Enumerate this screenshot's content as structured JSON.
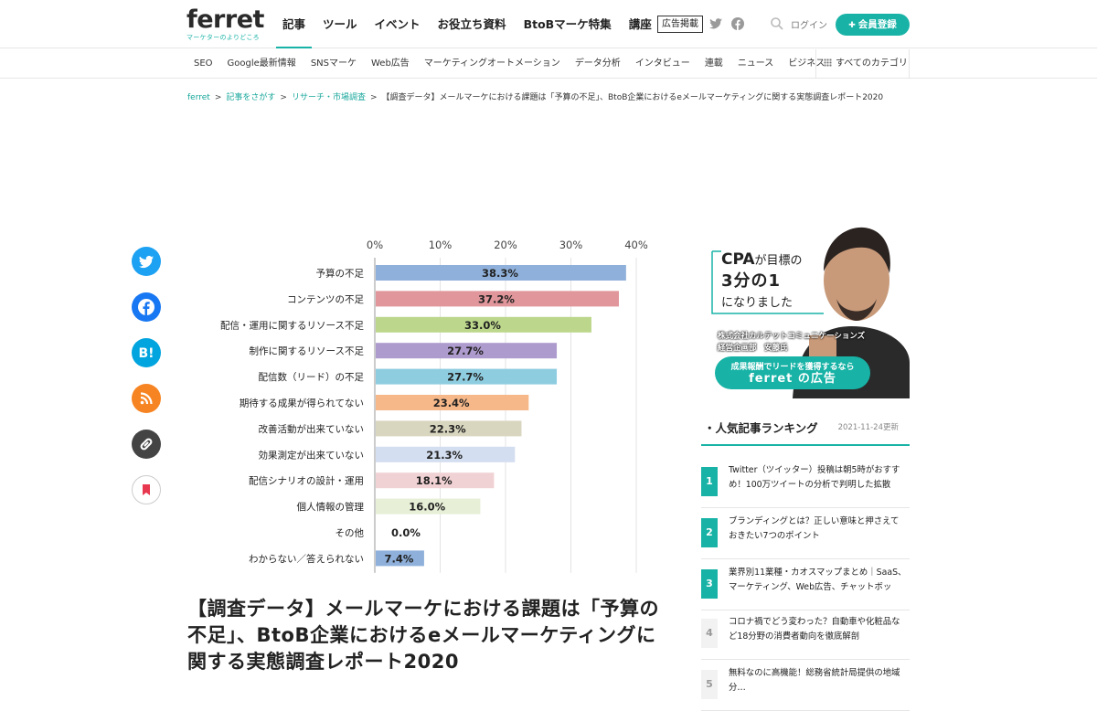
{
  "header": {
    "logo": "ferret",
    "logo_tagline": "マーケターのよりどころ",
    "nav": [
      "記事",
      "ツール",
      "イベント",
      "お役立ち資料",
      "BtoBマーケ特集",
      "講座"
    ],
    "ad_label": "広告掲載",
    "login": "ログイン",
    "signup": "会員登録"
  },
  "subnav": {
    "items": [
      "SEO",
      "Google最新情報",
      "SNSマーケ",
      "Web広告",
      "マーケティングオートメーション",
      "データ分析",
      "インタビュー",
      "連載",
      "ニュース",
      "ビジネス"
    ],
    "all_categories": "すべてのカテゴリ"
  },
  "breadcrumb": {
    "items": [
      "ferret",
      "記事をさがす",
      "リサーチ・市場調査"
    ],
    "current": "【調査データ】メールマーケにおける課題は「予算の不足」、BtoB企業におけるeメールマーケティングに関する実態調査レポート2020"
  },
  "share": [
    "twitter-icon",
    "facebook-icon",
    "hatena-bookmark-icon",
    "rss-icon",
    "link-icon",
    "bookmark-icon"
  ],
  "chart_data": {
    "type": "bar",
    "orientation": "horizontal",
    "xlim": [
      0,
      40
    ],
    "x_ticks": [
      "0%",
      "10%",
      "20%",
      "30%",
      "40%"
    ],
    "categories": [
      "予算の不足",
      "コンテンツの不足",
      "配信・運用に関するリソース不足",
      "制作に関するリソース不足",
      "配信数（リード）の不足",
      "期待する成果が得られてない",
      "改善活動が出来ていない",
      "効果測定が出来ていない",
      "配信シナリオの設計・運用",
      "個人情報の管理",
      "その他",
      "わからない／答えられない"
    ],
    "values": [
      38.3,
      37.2,
      33.0,
      27.7,
      27.7,
      23.4,
      22.3,
      21.3,
      18.1,
      16.0,
      0.0,
      7.4
    ],
    "value_labels": [
      "38.3%",
      "37.2%",
      "33.0%",
      "27.7%",
      "27.7%",
      "23.4%",
      "22.3%",
      "21.3%",
      "18.1%",
      "16.0%",
      "0.0%",
      "7.4%"
    ],
    "colors": [
      "#8fb0da",
      "#e0969a",
      "#bcd78b",
      "#ae9bcd",
      "#8ecde0",
      "#f6b889",
      "#d9d6bf",
      "#d3def0",
      "#f1d2d4",
      "#e7efd6",
      "#cccccc",
      "#8fb0da"
    ]
  },
  "article": {
    "title": "【調査データ】メールマーケにおける課題は「予算の不足」、BtoB企業におけるeメールマーケティングに関する実態調査レポート2020"
  },
  "ad": {
    "headline_1": "CPA",
    "headline_2": "が目標の",
    "headline_3": "3分の1",
    "headline_4": "になりました",
    "company": "株式会社カルテットコミュニケーションズ",
    "person": "経営企画部　安藤氏",
    "cta_1": "成果報酬でリードを獲得するなら",
    "cta_2": "ferret の広告"
  },
  "ranking": {
    "title": "・人気記事ランキング",
    "updated": "2021-11-24更新",
    "items": [
      {
        "rank": "1",
        "text": "Twitter（ツイッター）投稿は朝5時がおすすめ！100万ツイートの分析で判明した拡散（…"
      },
      {
        "rank": "2",
        "text": "ブランディングとは？正しい意味と押さえておきたい7つのポイント"
      },
      {
        "rank": "3",
        "text": "業界別11業種・カオスマップまとめ｜SaaS、マーケティング、Web広告、チャットボット、…"
      },
      {
        "rank": "4",
        "text": "コロナ禍でどう変わった？自動車や化粧品など18分野の消費者動向を徹底解剖"
      },
      {
        "rank": "5",
        "text": "無料なのに高機能！総務省統計局提供の地域分…"
      }
    ]
  }
}
